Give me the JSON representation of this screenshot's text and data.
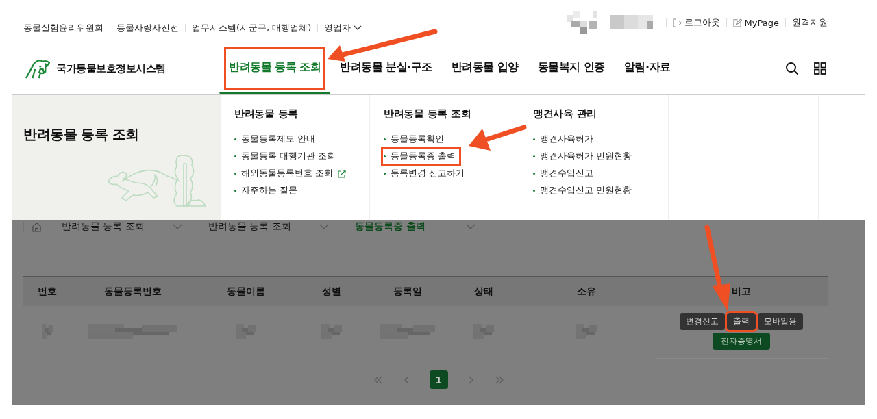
{
  "util_links": [
    {
      "label": "동물실험윤리위원회",
      "caret": false
    },
    {
      "label": "동물사랑사진전",
      "caret": false
    },
    {
      "label": "업무시스템(시군구, 대행업체)",
      "caret": false
    },
    {
      "label": "영업자",
      "caret": true
    }
  ],
  "user_links": [
    {
      "label": "로그아웃"
    },
    {
      "label": "MyPage"
    },
    {
      "label": "원격지원"
    }
  ],
  "logo": {
    "text": "국가동물보호정보시스템"
  },
  "nav": [
    {
      "label": "반려동물 등록 조회",
      "selected": true,
      "highlighted": true
    },
    {
      "label": "반려동물 분실·구조",
      "selected": false,
      "highlighted": false
    },
    {
      "label": "반려동물 입양",
      "selected": false,
      "highlighted": false
    },
    {
      "label": "동물복지 인증",
      "selected": false,
      "highlighted": false
    },
    {
      "label": "알림·자료",
      "selected": false,
      "highlighted": false
    }
  ],
  "mega_menu": {
    "title": "반려동물 등록 조회",
    "columns": [
      {
        "heading": "반려동물 등록",
        "items": [
          {
            "label": "동물등록제도 안내",
            "external": false,
            "highlighted": false
          },
          {
            "label": "동물등록 대행기관 조회",
            "external": false,
            "highlighted": false
          },
          {
            "label": "해외동물등록번호 조회",
            "external": true,
            "highlighted": false
          },
          {
            "label": "자주하는 질문",
            "external": false,
            "highlighted": false
          }
        ]
      },
      {
        "heading": "반려동물 등록 조회",
        "items": [
          {
            "label": "동물등록확인",
            "external": false,
            "highlighted": false
          },
          {
            "label": "동물등록증 출력",
            "external": false,
            "highlighted": true
          },
          {
            "label": "등록변경 신고하기",
            "external": false,
            "highlighted": false
          }
        ]
      },
      {
        "heading": "맹견사육 관리",
        "items": [
          {
            "label": "맹견사육허가",
            "external": false,
            "highlighted": false
          },
          {
            "label": "맹견사육허가 민원현황",
            "external": false,
            "highlighted": false
          },
          {
            "label": "맹견수입신고",
            "external": false,
            "highlighted": false
          },
          {
            "label": "맹견수입신고 민원현황",
            "external": false,
            "highlighted": false
          }
        ]
      }
    ]
  },
  "breadcrumb": [
    {
      "label": "반려동물 등록 조회",
      "current": false
    },
    {
      "label": "반려동물 등록 조회",
      "current": false
    },
    {
      "label": "동물등록증 출력",
      "current": true
    }
  ],
  "table": {
    "columns": [
      "번호",
      "동물등록번호",
      "동물이름",
      "성별",
      "등록일",
      "상태",
      "소유",
      "비고"
    ],
    "rows": [
      {
        "actions": [
          {
            "label": "변경신고",
            "kind": "dark",
            "highlighted": false
          },
          {
            "label": "출력",
            "kind": "dark",
            "highlighted": true
          },
          {
            "label": "모바일용",
            "kind": "dark",
            "highlighted": false
          },
          {
            "label": "전자증명서",
            "kind": "green",
            "highlighted": false
          }
        ]
      }
    ]
  },
  "pagination": {
    "pages": [
      {
        "label": "1",
        "selected": true
      }
    ]
  }
}
